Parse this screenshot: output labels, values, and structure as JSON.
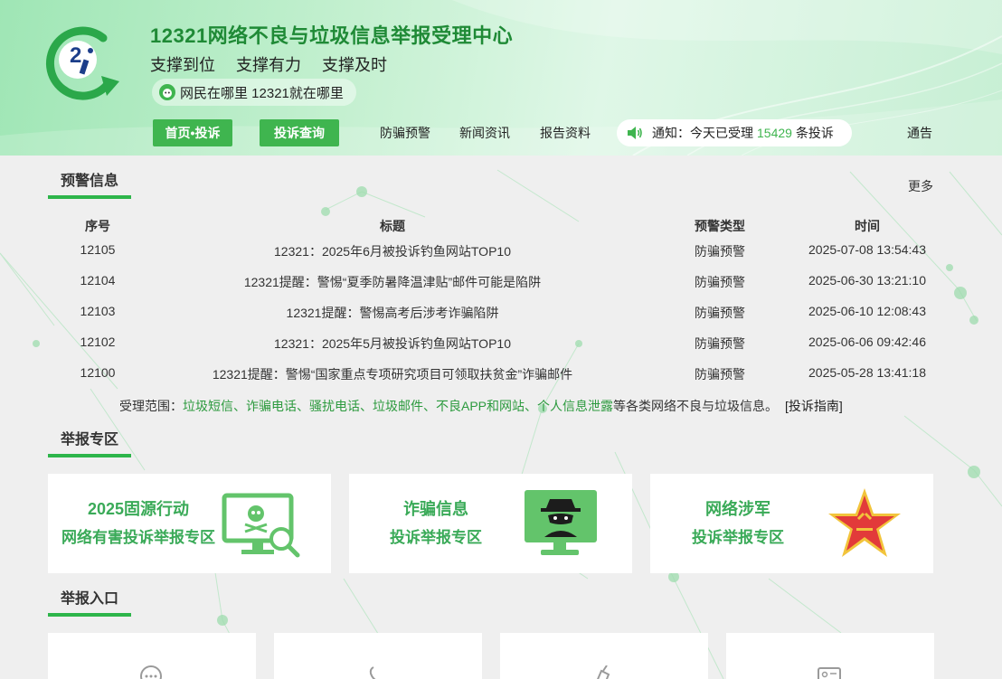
{
  "header": {
    "title": "12321网络不良与垃圾信息举报受理中心",
    "slogans": [
      "支撑到位",
      "支撑有力",
      "支撑及时"
    ],
    "motto": "网民在哪里 12321就在哪里"
  },
  "nav": {
    "home_label": "首页•投诉",
    "query_label": "投诉查询",
    "links": [
      "防骗预警",
      "新闻资讯",
      "报告资料"
    ],
    "notice_prefix": "通知：今天已受理",
    "notice_count": "15429",
    "notice_suffix": "条投诉",
    "announce_label": "通告"
  },
  "warning": {
    "heading": "预警信息",
    "more_label": "更多",
    "columns": [
      "序号",
      "标题",
      "预警类型",
      "时间"
    ],
    "rows": [
      {
        "id": "12105",
        "title": "12321：2025年6月被投诉钓鱼网站TOP10",
        "type": "防骗预警",
        "time": "2025-07-08 13:54:43"
      },
      {
        "id": "12104",
        "title": "12321提醒：警惕“夏季防暑降温津贴”邮件可能是陷阱",
        "type": "防骗预警",
        "time": "2025-06-30 13:21:10"
      },
      {
        "id": "12103",
        "title": "12321提醒：警惕高考后涉考诈骗陷阱",
        "type": "防骗预警",
        "time": "2025-06-10 12:08:43"
      },
      {
        "id": "12102",
        "title": "12321：2025年5月被投诉钓鱼网站TOP10",
        "type": "防骗预警",
        "time": "2025-06-06 09:42:46"
      },
      {
        "id": "12100",
        "title": "12321提醒：警惕“国家重点专项研究项目可领取扶贫金”诈骗邮件",
        "type": "防骗预警",
        "time": "2025-05-28 13:41:18"
      }
    ]
  },
  "scope": {
    "label": "受理范围：",
    "items": "垃圾短信、诈骗电话、骚扰电话、垃圾邮件、不良APP和网站、个人信息泄露",
    "suffix": "等各类网络不良与垃圾信息。",
    "guide": "[投诉指南]"
  },
  "zone": {
    "heading": "举报专区",
    "cards": [
      {
        "line1": "2025固源行动",
        "line2": "网络有害投诉举报专区",
        "icon": "monitor-skull-search-icon"
      },
      {
        "line1": "诈骗信息",
        "line2": "投诉举报专区",
        "icon": "monitor-spy-icon"
      },
      {
        "line1": "网络涉军",
        "line2": "投诉举报专区",
        "icon": "red-star-badge-icon"
      }
    ]
  },
  "entry": {
    "heading": "举报入口",
    "icons": [
      "sms-icon",
      "phone-icon",
      "broom-icon",
      "id-card-icon"
    ]
  },
  "colors": {
    "accent": "#3fb54f",
    "title": "#1f8a36",
    "card_text": "#3aaa58",
    "star": "#e23a3a"
  }
}
